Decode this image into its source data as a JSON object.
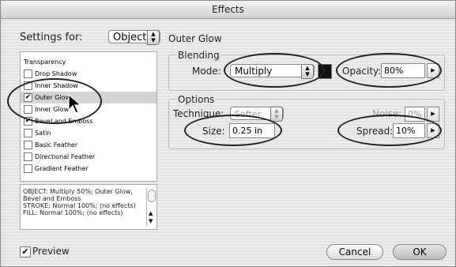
{
  "window": {
    "title": "Effects"
  },
  "settings_for": {
    "label": "Settings for:",
    "value": "Object"
  },
  "list": {
    "header": "Transparency",
    "items": [
      {
        "label": "Drop Shadow",
        "checked": false
      },
      {
        "label": "Inner Shadow",
        "checked": false
      },
      {
        "label": "Outer Glow",
        "checked": true
      },
      {
        "label": "Inner Glow",
        "checked": false
      },
      {
        "label": "Bevel and Emboss",
        "checked": true
      },
      {
        "label": "Satin",
        "checked": false
      },
      {
        "label": "Basic Feather",
        "checked": false
      },
      {
        "label": "Directional Feather",
        "checked": false
      },
      {
        "label": "Gradient Feather",
        "checked": false
      }
    ]
  },
  "summary": "OBJECT: Multiply 50%; Outer Glow, Bevel and Emboss\nSTROKE: Normal 100%; (no effects)\nFILL: Normal 100%; (no effects)",
  "panel": {
    "title": "Outer Glow",
    "blending": {
      "legend": "Blending",
      "mode_label": "Mode:",
      "mode_value": "Multiply",
      "opacity_label": "Opacity:",
      "opacity_value": "80%"
    },
    "options": {
      "legend": "Options",
      "technique_label": "Technique:",
      "technique_value": "Softer",
      "noise_label": "Noise:",
      "noise_value": "0%",
      "size_label": "Size:",
      "size_value": "0.25 in",
      "spread_label": "Spread:",
      "spread_value": "10%"
    }
  },
  "preview": {
    "label": "Preview",
    "checked": true
  },
  "buttons": {
    "cancel": "Cancel",
    "ok": "OK"
  }
}
